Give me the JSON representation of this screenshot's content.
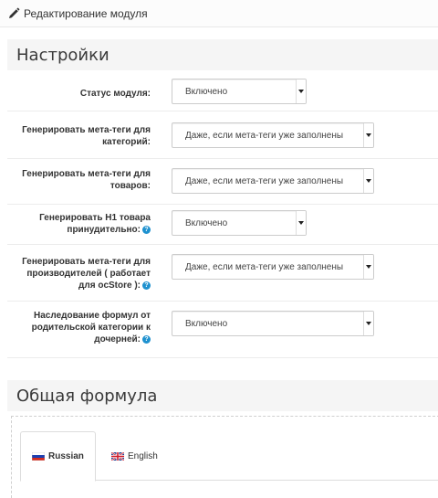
{
  "breadcrumb": {
    "title": "Редактирование модуля",
    "icon": "pencil-icon"
  },
  "settings": {
    "heading": "Настройки",
    "rows": [
      {
        "label": "Статус модуля:",
        "value": "Включено",
        "help": false
      },
      {
        "label": "Генерировать мета-теги для категорий:",
        "value": "Даже, если мета-теги уже заполнены",
        "help": false
      },
      {
        "label": "Генерировать мета-теги для товаров:",
        "value": "Даже, если мета-теги уже заполнены",
        "help": false
      },
      {
        "label": "Генерировать H1 товара принудительно:",
        "value": "Включено",
        "help": true
      },
      {
        "label": "Генерировать мета-теги для производителей ( работает для ocStore ):",
        "value": "Даже, если мета-теги уже заполнены",
        "help": true
      },
      {
        "label": "Наследование формул от родительской категории к дочерней:",
        "value": "Включено",
        "help": true
      }
    ]
  },
  "formula": {
    "heading": "Общая формула",
    "tabs": [
      {
        "label": "Russian",
        "active": true
      },
      {
        "label": "English",
        "active": false
      }
    ]
  },
  "colors": {
    "help_badge": "#1e91cf",
    "section_bg": "#f5f5f5"
  }
}
